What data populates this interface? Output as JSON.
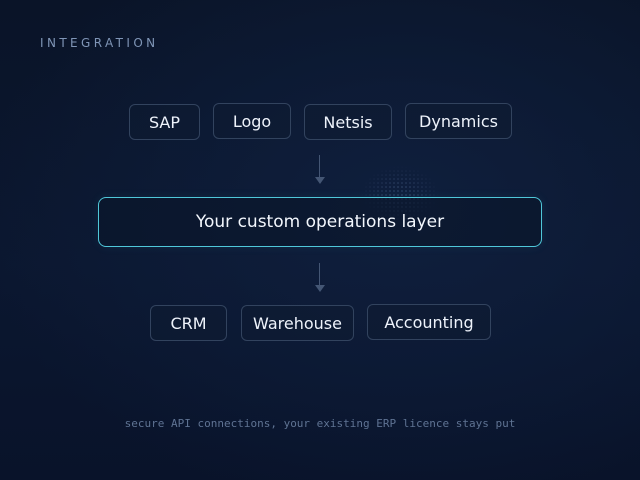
{
  "header": {
    "eyebrow": "INTEGRATION"
  },
  "sources": [
    {
      "label": "SAP"
    },
    {
      "label": "Logo"
    },
    {
      "label": "Netsis"
    },
    {
      "label": "Dynamics"
    }
  ],
  "core": {
    "label": "Your custom operations layer"
  },
  "destinations": [
    {
      "label": "CRM"
    },
    {
      "label": "Warehouse"
    },
    {
      "label": "Accounting"
    }
  ],
  "footnote": "secure API connections, your existing ERP licence stays put",
  "colors": {
    "background": "#0b1730",
    "chip_border": "#32435e",
    "accent_border": "#4fc7d9",
    "connector": "#445674",
    "muted_text": "#7f95b6"
  }
}
